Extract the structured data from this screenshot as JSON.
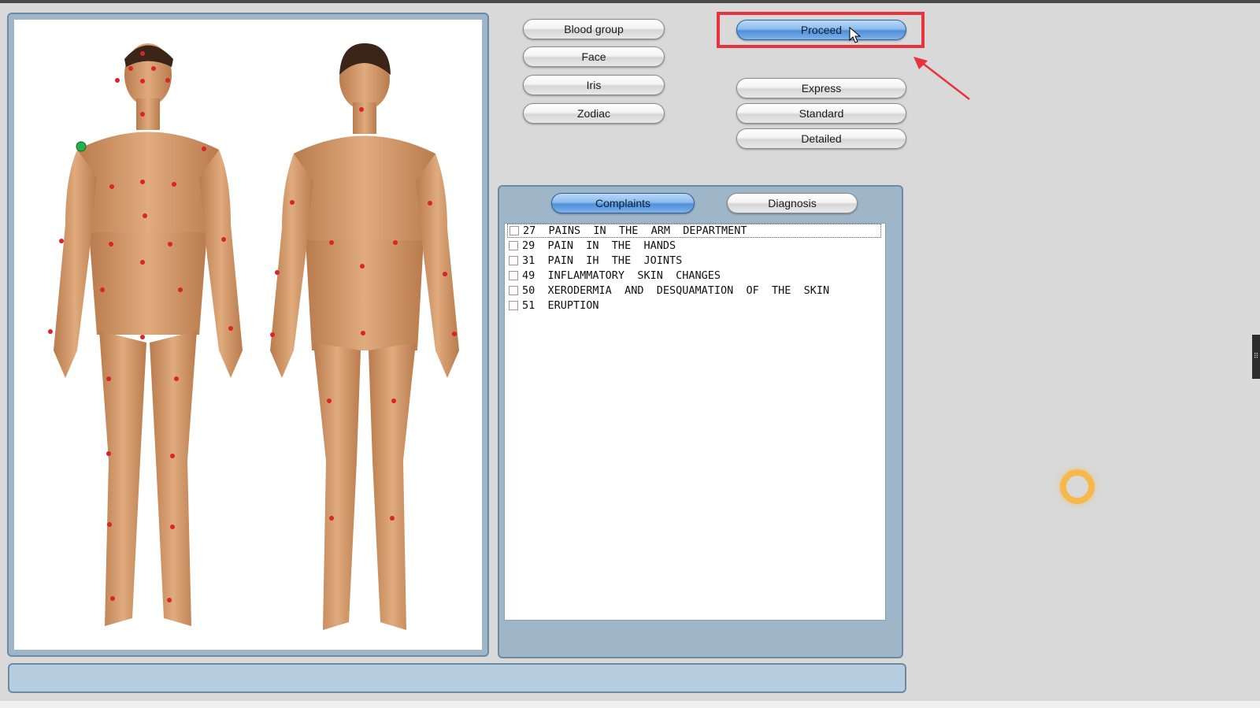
{
  "buttons": {
    "blood_group": "Blood group",
    "face": "Face",
    "iris": "Iris",
    "zodiac": "Zodiac",
    "proceed": "Proceed",
    "express": "Express",
    "standard": "Standard",
    "detailed": "Detailed"
  },
  "tabs": {
    "complaints": "Complaints",
    "diagnosis": "Diagnosis",
    "active": "complaints"
  },
  "complaints": [
    {
      "code": "27",
      "text": "PAINS  IN  THE  ARM  DEPARTMENT",
      "checked": false,
      "selected": true
    },
    {
      "code": "29",
      "text": "PAIN  IN  THE  HANDS",
      "checked": false,
      "selected": false
    },
    {
      "code": "31",
      "text": "PAIN  IH  THE  JOINTS",
      "checked": false,
      "selected": false
    },
    {
      "code": "49",
      "text": "INFLAMMATORY  SKIN  CHANGES",
      "checked": false,
      "selected": false
    },
    {
      "code": "50",
      "text": "XERODERMIA  AND  DESQUAMATION  OF  THE  SKIN",
      "checked": false,
      "selected": false
    },
    {
      "code": "51",
      "text": "ERUPTION",
      "checked": false,
      "selected": false
    }
  ],
  "status_bar": {
    "text": ""
  },
  "colors": {
    "skin": "#d19a6a",
    "point": "#d8242a",
    "selected_point": "#21b34a",
    "highlight": "#e8333c",
    "panel": "#9fb6c8"
  },
  "icons": [
    "cursor-arrow-icon",
    "annotation-arrow-icon",
    "loading-ring-icon"
  ]
}
